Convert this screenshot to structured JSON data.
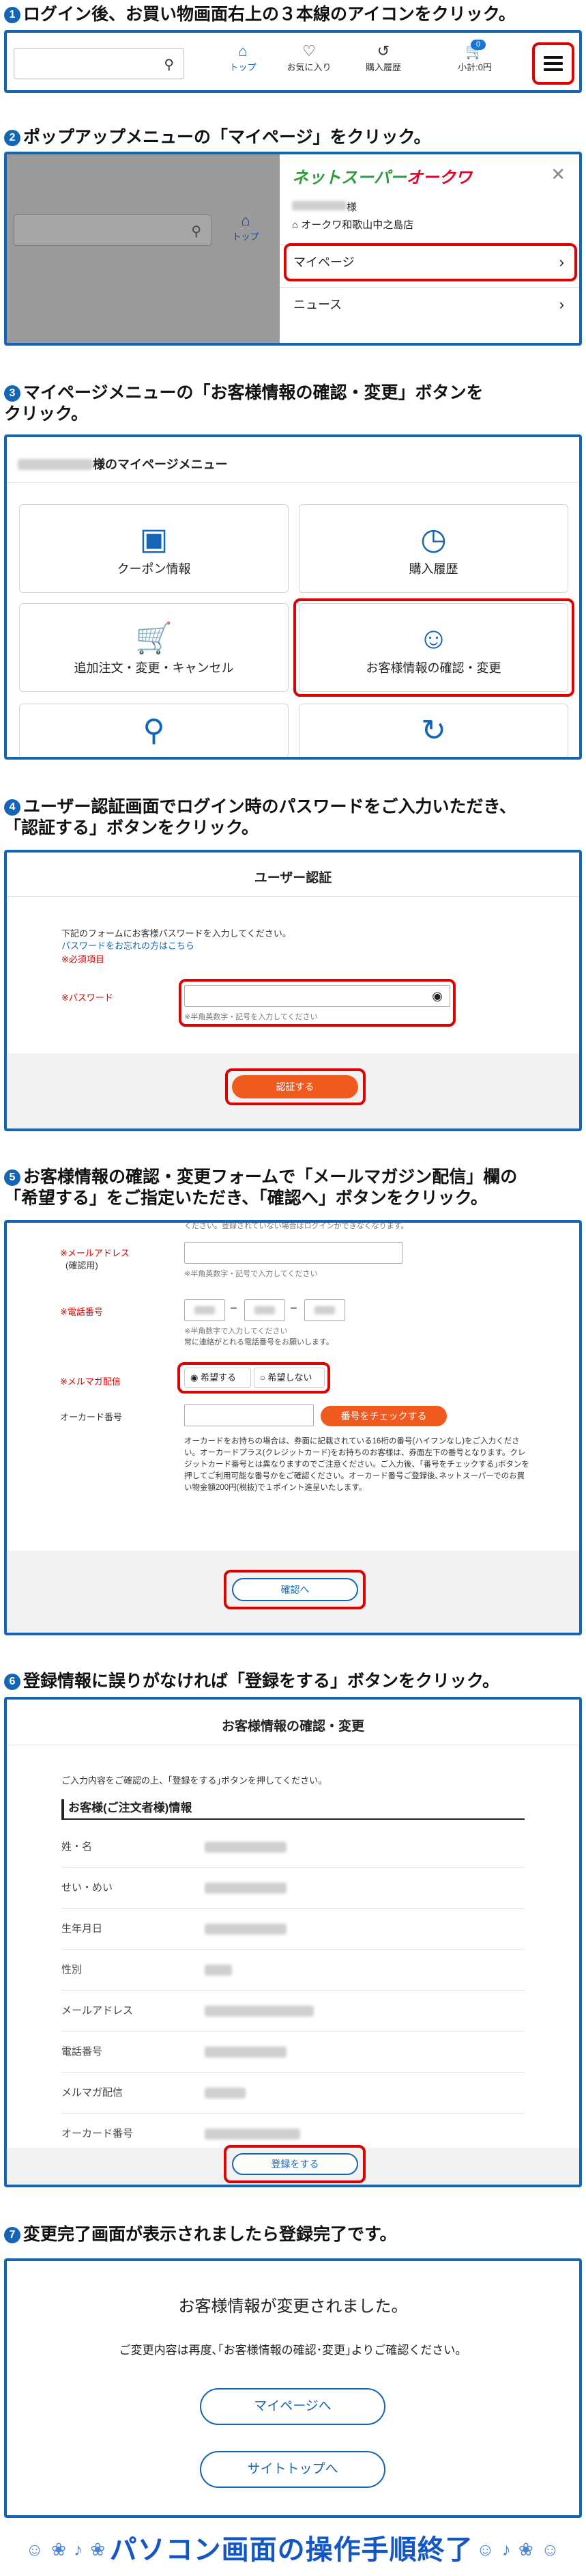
{
  "steps": [
    {
      "num": "1",
      "text": "ログイン後、お買い物画面右上の３本線のアイコンをクリック。"
    },
    {
      "num": "2",
      "text": "ポップアップメニューの「マイページ」をクリック。"
    },
    {
      "num": "3",
      "text": "マイページメニューの「お客様情報の確認・変更」ボタンを\nクリック。"
    },
    {
      "num": "4",
      "text": "ユーザー認証画面でログイン時のパスワードをご入力いただき、\n「認証する」ボタンをクリック。"
    },
    {
      "num": "5",
      "text": "お客様情報の確認・変更フォームで「メールマガジン配信」欄の\n「希望する」をご指定いただき、「確認へ」ボタンをクリック。"
    },
    {
      "num": "6",
      "text": "登録情報に誤りがなければ「登録をする」ボタンをクリック。"
    },
    {
      "num": "7",
      "text": "変更完了画面が表示されましたら登録完了です。"
    }
  ],
  "header": {
    "nav": [
      "トップ",
      "お気に入り",
      "購入履歴",
      "小計:0円"
    ],
    "cart_count": "0",
    "icons": [
      "search-icon",
      "home-icon",
      "heart-icon",
      "history-icon",
      "cart-icon",
      "hamburger-icon"
    ]
  },
  "popup": {
    "brand_green": "ネットスーパー",
    "brand_red": "オークワ",
    "user_suffix": "様",
    "store": "オークワ和歌山中之島店",
    "menu": [
      "マイページ",
      "ニュース"
    ],
    "top_label": "トップ"
  },
  "mypage": {
    "heading_suffix": "様のマイページメニュー",
    "tiles": [
      "クーポン情報",
      "購入履歴",
      "追加注文・変更・キャンセル",
      "お客様情報の確認・変更"
    ]
  },
  "auth": {
    "title": "ユーザー認証",
    "intro": "下記のフォームにお客様パスワードを入力してください。",
    "forgot": "パスワードをお忘れの方はこちら",
    "required_note": "※必須項目",
    "password_label": "※パスワード",
    "password_hint": "※半角英数字・記号を入力してください",
    "submit": "認証する"
  },
  "form": {
    "top_cut": "ください。登録されていない場合はログインができなくなります。",
    "email_label": "※メールアドレス",
    "email_sub": "(確認用)",
    "email_hint": "※半角英数字・記号で入力してください",
    "phone_label": "※電話番号",
    "phone_hint": "※半角数字で入力してください",
    "phone_hint2": "常に連絡がとれる電話番号をお願いします。",
    "newsletter_label": "※メルマガ配信",
    "newsletter_yes": "希望する",
    "newsletter_no": "希望しない",
    "card_label": "オーカード番号",
    "card_button": "番号をチェックする",
    "card_note": "オーカードをお持ちの場合は、券面に記載されている16桁の番号(ハイフンなし)をご入力ください。オーカードプラス(クレジットカード)をお持ちのお客様は、券面左下の番号となります。クレジットカード番号とは異なりますのでご注意ください。ご入力後、｢番号をチェックする｣ボタンを押してご利用可能な番号かをご確認ください。オーカード番号ご登録後､ネットスーパーでのお買い物金額200円(税抜)で１ポイント進呈いたします。",
    "confirm_button": "確認へ"
  },
  "review": {
    "title": "お客様情報の確認・変更",
    "intro": "ご入力内容をご確認の上、｢登録をする｣ボタンを押してください。",
    "section": "お客様(ご注文者様)情報",
    "fields": [
      "姓・名",
      "せい・めい",
      "生年月日",
      "性別",
      "メールアドレス",
      "電話番号",
      "メルマガ配信",
      "オーカード番号"
    ],
    "submit": "登録をする"
  },
  "done": {
    "message": "お客様情報が変更されました。",
    "note": "ご変更内容は再度､｢お客様情報の確認･変更｣よりご確認ください。",
    "btn_mypage": "マイページへ",
    "btn_top": "サイトトップへ"
  },
  "footer": {
    "text": "パソコン画面の操作手順終了",
    "deco_left": "☺ ❀ ♪ ❀",
    "deco_right": "☺ ♪ ❀ ☺"
  },
  "colors": {
    "frame": "#1565b6",
    "highlight": "#e00000",
    "button": "#f05a1e"
  }
}
